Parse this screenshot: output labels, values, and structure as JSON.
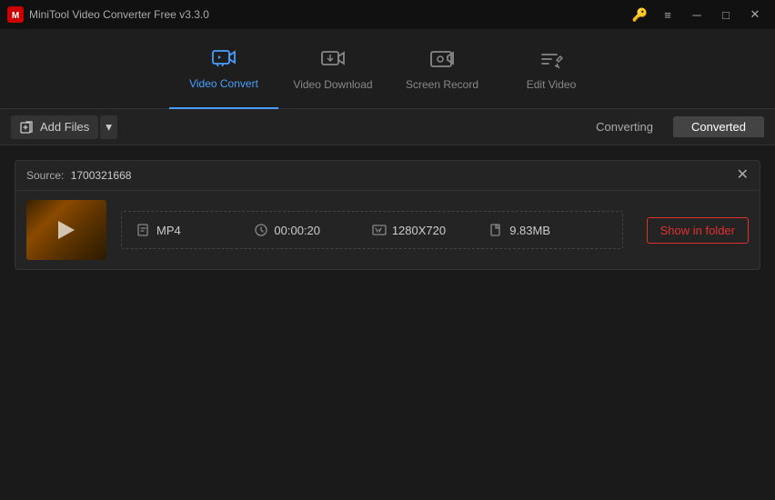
{
  "app": {
    "title": "MiniTool Video Converter Free v3.3.0"
  },
  "titlebar": {
    "key_icon": "🔑",
    "hamburger": "≡",
    "minimize": "─",
    "maximize": "□",
    "close": "✕"
  },
  "nav": {
    "items": [
      {
        "id": "video-convert",
        "label": "Video Convert",
        "active": true
      },
      {
        "id": "video-download",
        "label": "Video Download",
        "active": false
      },
      {
        "id": "screen-record",
        "label": "Screen Record",
        "active": false
      },
      {
        "id": "edit-video",
        "label": "Edit Video",
        "active": false
      }
    ]
  },
  "toolbar": {
    "add_files_label": "Add Files",
    "tabs": [
      {
        "id": "converting",
        "label": "Converting",
        "active": false
      },
      {
        "id": "converted",
        "label": "Converted",
        "active": true
      }
    ]
  },
  "converted_item": {
    "source_label": "Source:",
    "source_value": "1700321668",
    "format": "MP4",
    "duration": "00:00:20",
    "resolution": "1280X720",
    "filesize": "9.83MB",
    "show_in_folder_label": "Show in folder"
  }
}
